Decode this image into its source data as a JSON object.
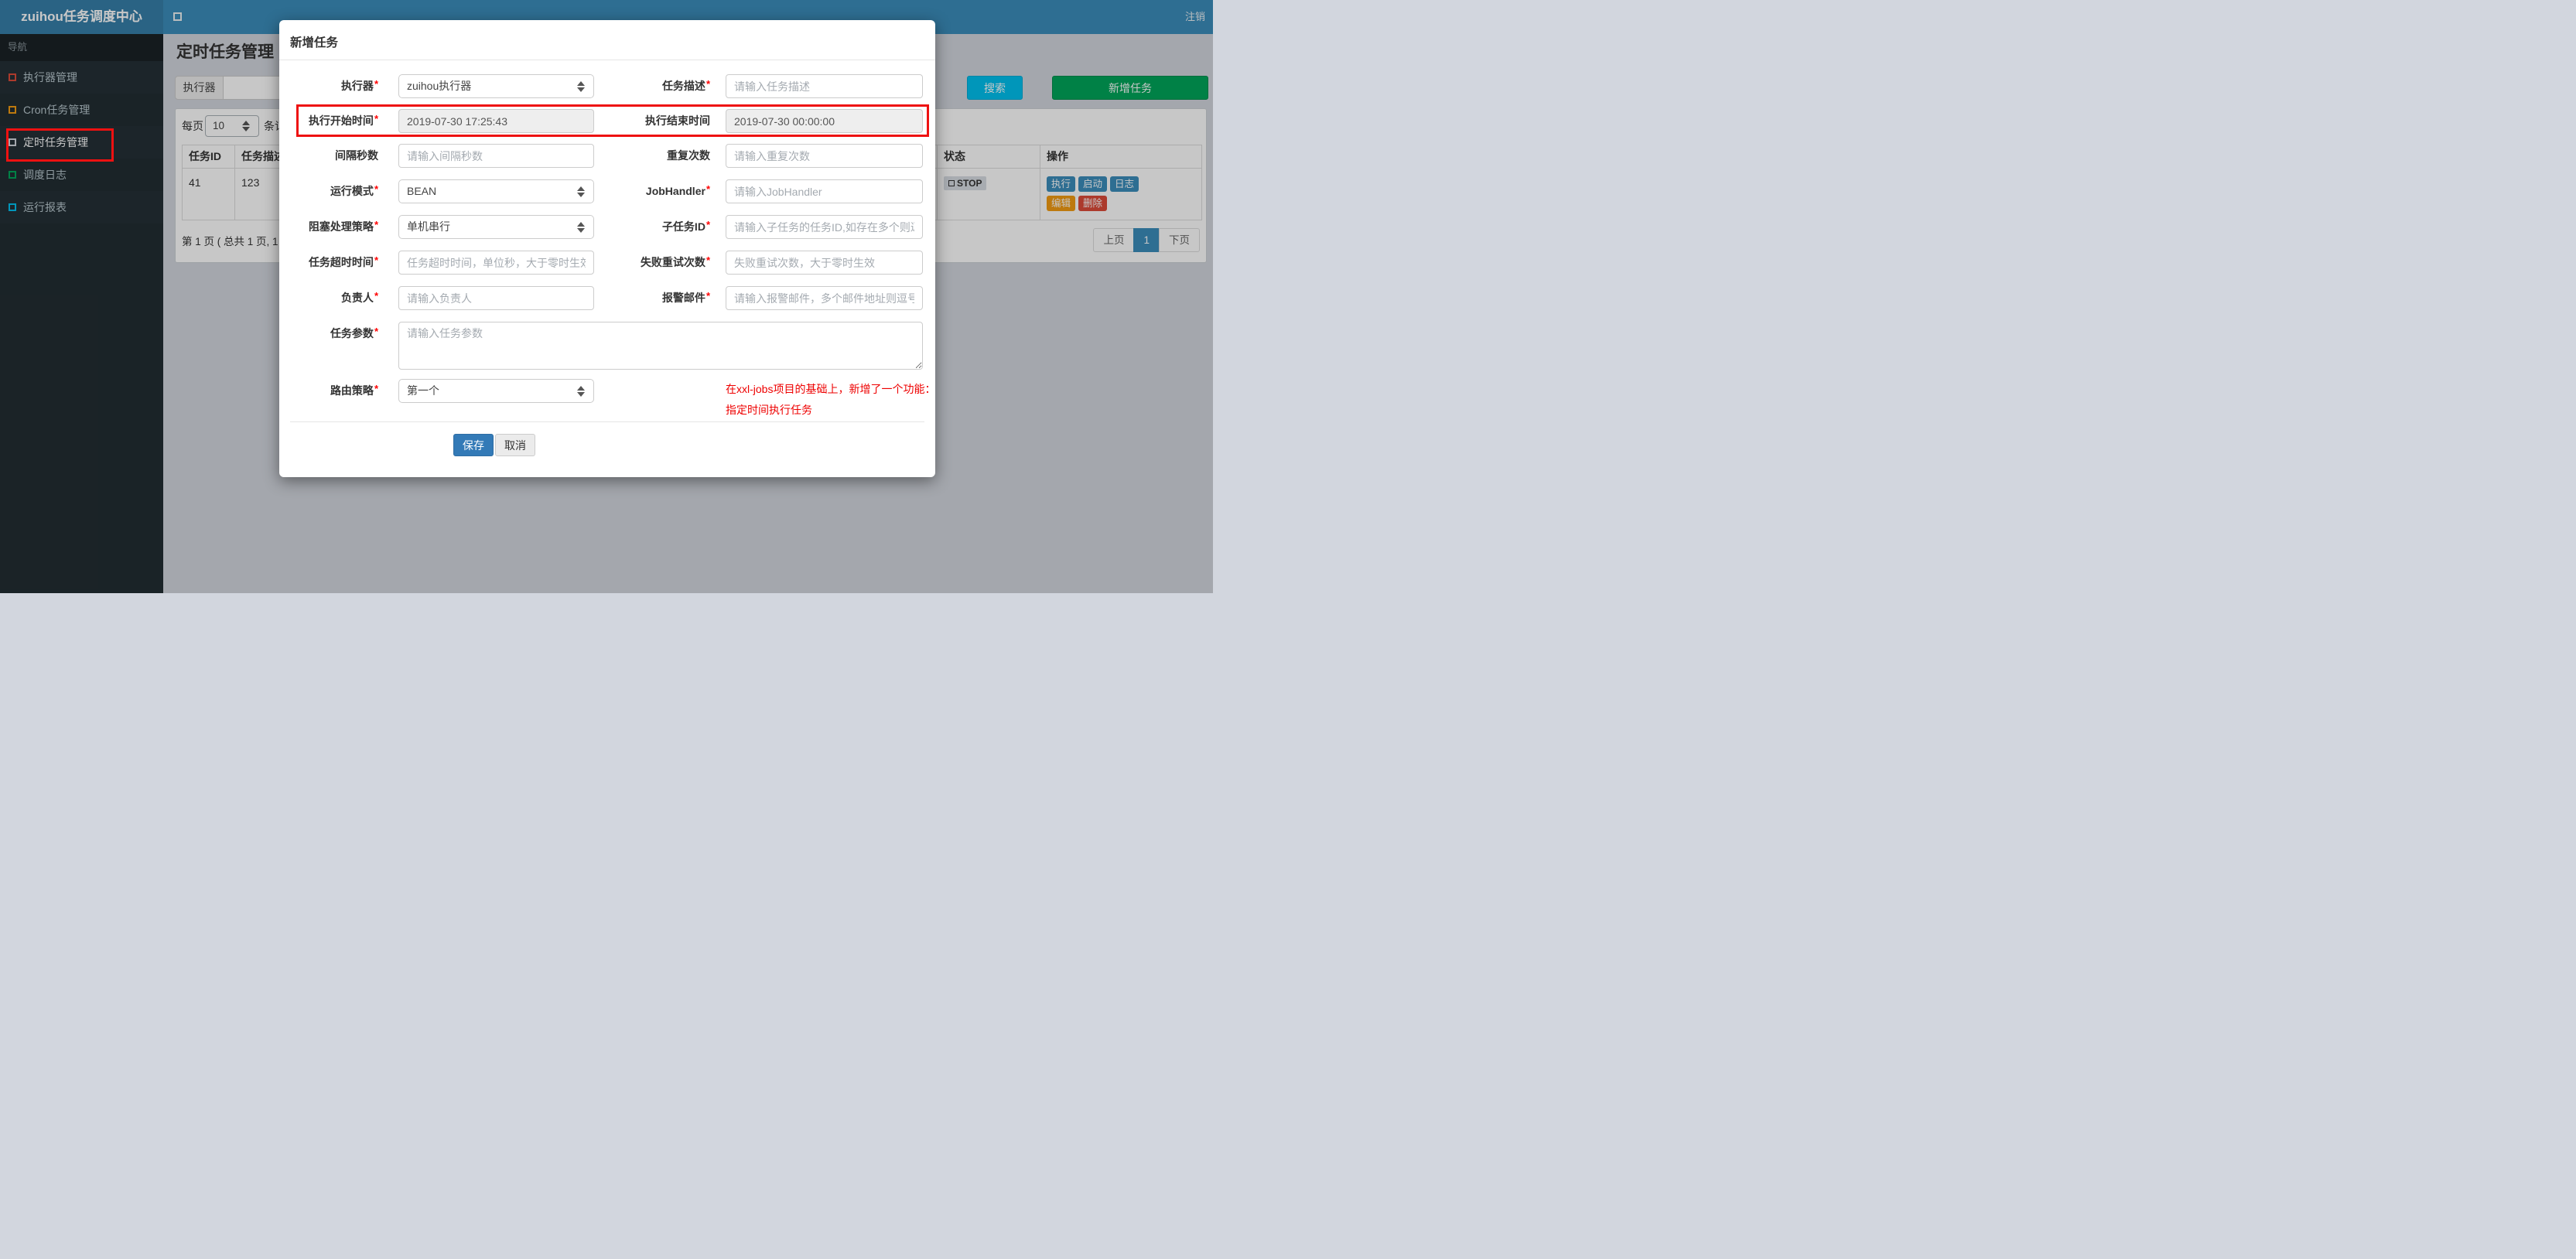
{
  "navbar": {
    "brand": "zuihou任务调度中心",
    "logout_label": "注销"
  },
  "sidebar": {
    "section_label": "导航",
    "items": [
      {
        "label": "执行器管理",
        "icon": "square-outline-icon",
        "icon_color": "#dd4b39",
        "active": false
      },
      {
        "label": "Cron任务管理",
        "icon": "square-outline-icon",
        "icon_color": "#f39c12",
        "active": false
      },
      {
        "label": "定时任务管理",
        "icon": "square-outline-icon",
        "icon_color": "#d2d6de",
        "active": true,
        "annotated": true
      },
      {
        "label": "调度日志",
        "icon": "square-outline-icon",
        "icon_color": "#00a65a",
        "active": false
      },
      {
        "label": "运行报表",
        "icon": "square-outline-icon",
        "icon_color": "#00c0ef",
        "active": false
      }
    ]
  },
  "page": {
    "title": "定时任务管理",
    "filter": {
      "executor_label": "执行器",
      "executor_value": "",
      "search_label": "搜索",
      "add_task_label": "新增任务"
    },
    "list_toolbar": {
      "per_page_prefix": "每页",
      "per_page_value": "10",
      "per_page_suffix": "条记录"
    },
    "table": {
      "headers": [
        "任务ID",
        "任务描述",
        "状态",
        "操作"
      ],
      "rows": [
        {
          "job_id": "41",
          "desc": "123",
          "status": "STOP",
          "actions": [
            {
              "label": "执行",
              "color": "#3c8dbc"
            },
            {
              "label": "启动",
              "color": "#3c8dbc"
            },
            {
              "label": "日志",
              "color": "#3c8dbc"
            },
            {
              "label": "编辑",
              "color": "#f39c12"
            },
            {
              "label": "删除",
              "color": "#dd4b39"
            }
          ]
        }
      ]
    },
    "pagination": {
      "summary": "第 1 页 ( 总共 1 页, 1",
      "prev": "上页",
      "current": "1",
      "next": "下页"
    }
  },
  "modal": {
    "title": "新增任务",
    "required_mark": "*",
    "form": {
      "executor": {
        "label": "执行器",
        "required": true,
        "type": "select",
        "value": "zuihou执行器"
      },
      "job_desc": {
        "label": "任务描述",
        "required": true,
        "type": "input",
        "placeholder": "请输入任务描述"
      },
      "start_time": {
        "label": "执行开始时间",
        "required": true,
        "type": "readonly",
        "value": "2019-07-30 17:25:43"
      },
      "end_time": {
        "label": "执行结束时间",
        "required": false,
        "type": "readonly",
        "value": "2019-07-30 00:00:00"
      },
      "interval_seconds": {
        "label": "间隔秒数",
        "required": false,
        "type": "input",
        "placeholder": "请输入间隔秒数"
      },
      "repeat_count": {
        "label": "重复次数",
        "required": false,
        "type": "input",
        "placeholder": "请输入重复次数"
      },
      "glue_type": {
        "label": "运行模式",
        "required": true,
        "type": "select",
        "value": "BEAN"
      },
      "job_handler": {
        "label": "JobHandler",
        "required": true,
        "type": "input",
        "placeholder": "请输入JobHandler"
      },
      "block_strategy": {
        "label": "阻塞处理策略",
        "required": true,
        "type": "select",
        "value": "单机串行"
      },
      "child_job_id": {
        "label": "子任务ID",
        "required": true,
        "type": "input",
        "placeholder": "请输入子任务的任务ID,如存在多个则逗号分隔"
      },
      "timeout": {
        "label": "任务超时时间",
        "required": true,
        "type": "input",
        "placeholder": "任务超时时间，单位秒，大于零时生效"
      },
      "fail_retry": {
        "label": "失败重试次数",
        "required": true,
        "type": "input",
        "placeholder": "失败重试次数，大于零时生效"
      },
      "owner": {
        "label": "负责人",
        "required": true,
        "type": "input",
        "placeholder": "请输入负责人"
      },
      "alarm_email": {
        "label": "报警邮件",
        "required": true,
        "type": "input",
        "placeholder": "请输入报警邮件，多个邮件地址则逗号分隔"
      },
      "job_param": {
        "label": "任务参数",
        "required": true,
        "type": "textarea",
        "placeholder": "请输入任务参数"
      },
      "route_strategy": {
        "label": "路由策略",
        "required": true,
        "type": "select",
        "value": "第一个"
      }
    },
    "note": {
      "line1": "在xxl-jobs项目的基础上，新增了一个功能：",
      "line2": "指定时间执行任务",
      "color": "#ee0000"
    },
    "footer": {
      "save_label": "保存",
      "cancel_label": "取消"
    }
  },
  "annotations": {
    "color": "#ee1111",
    "sidebar_box_target": "定时任务管理 menu item",
    "modal_box_target": "执行开始时间 / 执行结束时间 row"
  },
  "colors": {
    "navbar": "#3c8dbc",
    "logo_bg": "#367fa9",
    "sidebar_bg": "#222d32",
    "content_bg": "#d2d6de",
    "primary": "#337ab7",
    "info": "#00c0ef",
    "success": "#00a65a",
    "warning": "#f39c12",
    "danger": "#dd4b39",
    "active_page": "#3c8dbc",
    "readonly_bg": "#eee"
  }
}
